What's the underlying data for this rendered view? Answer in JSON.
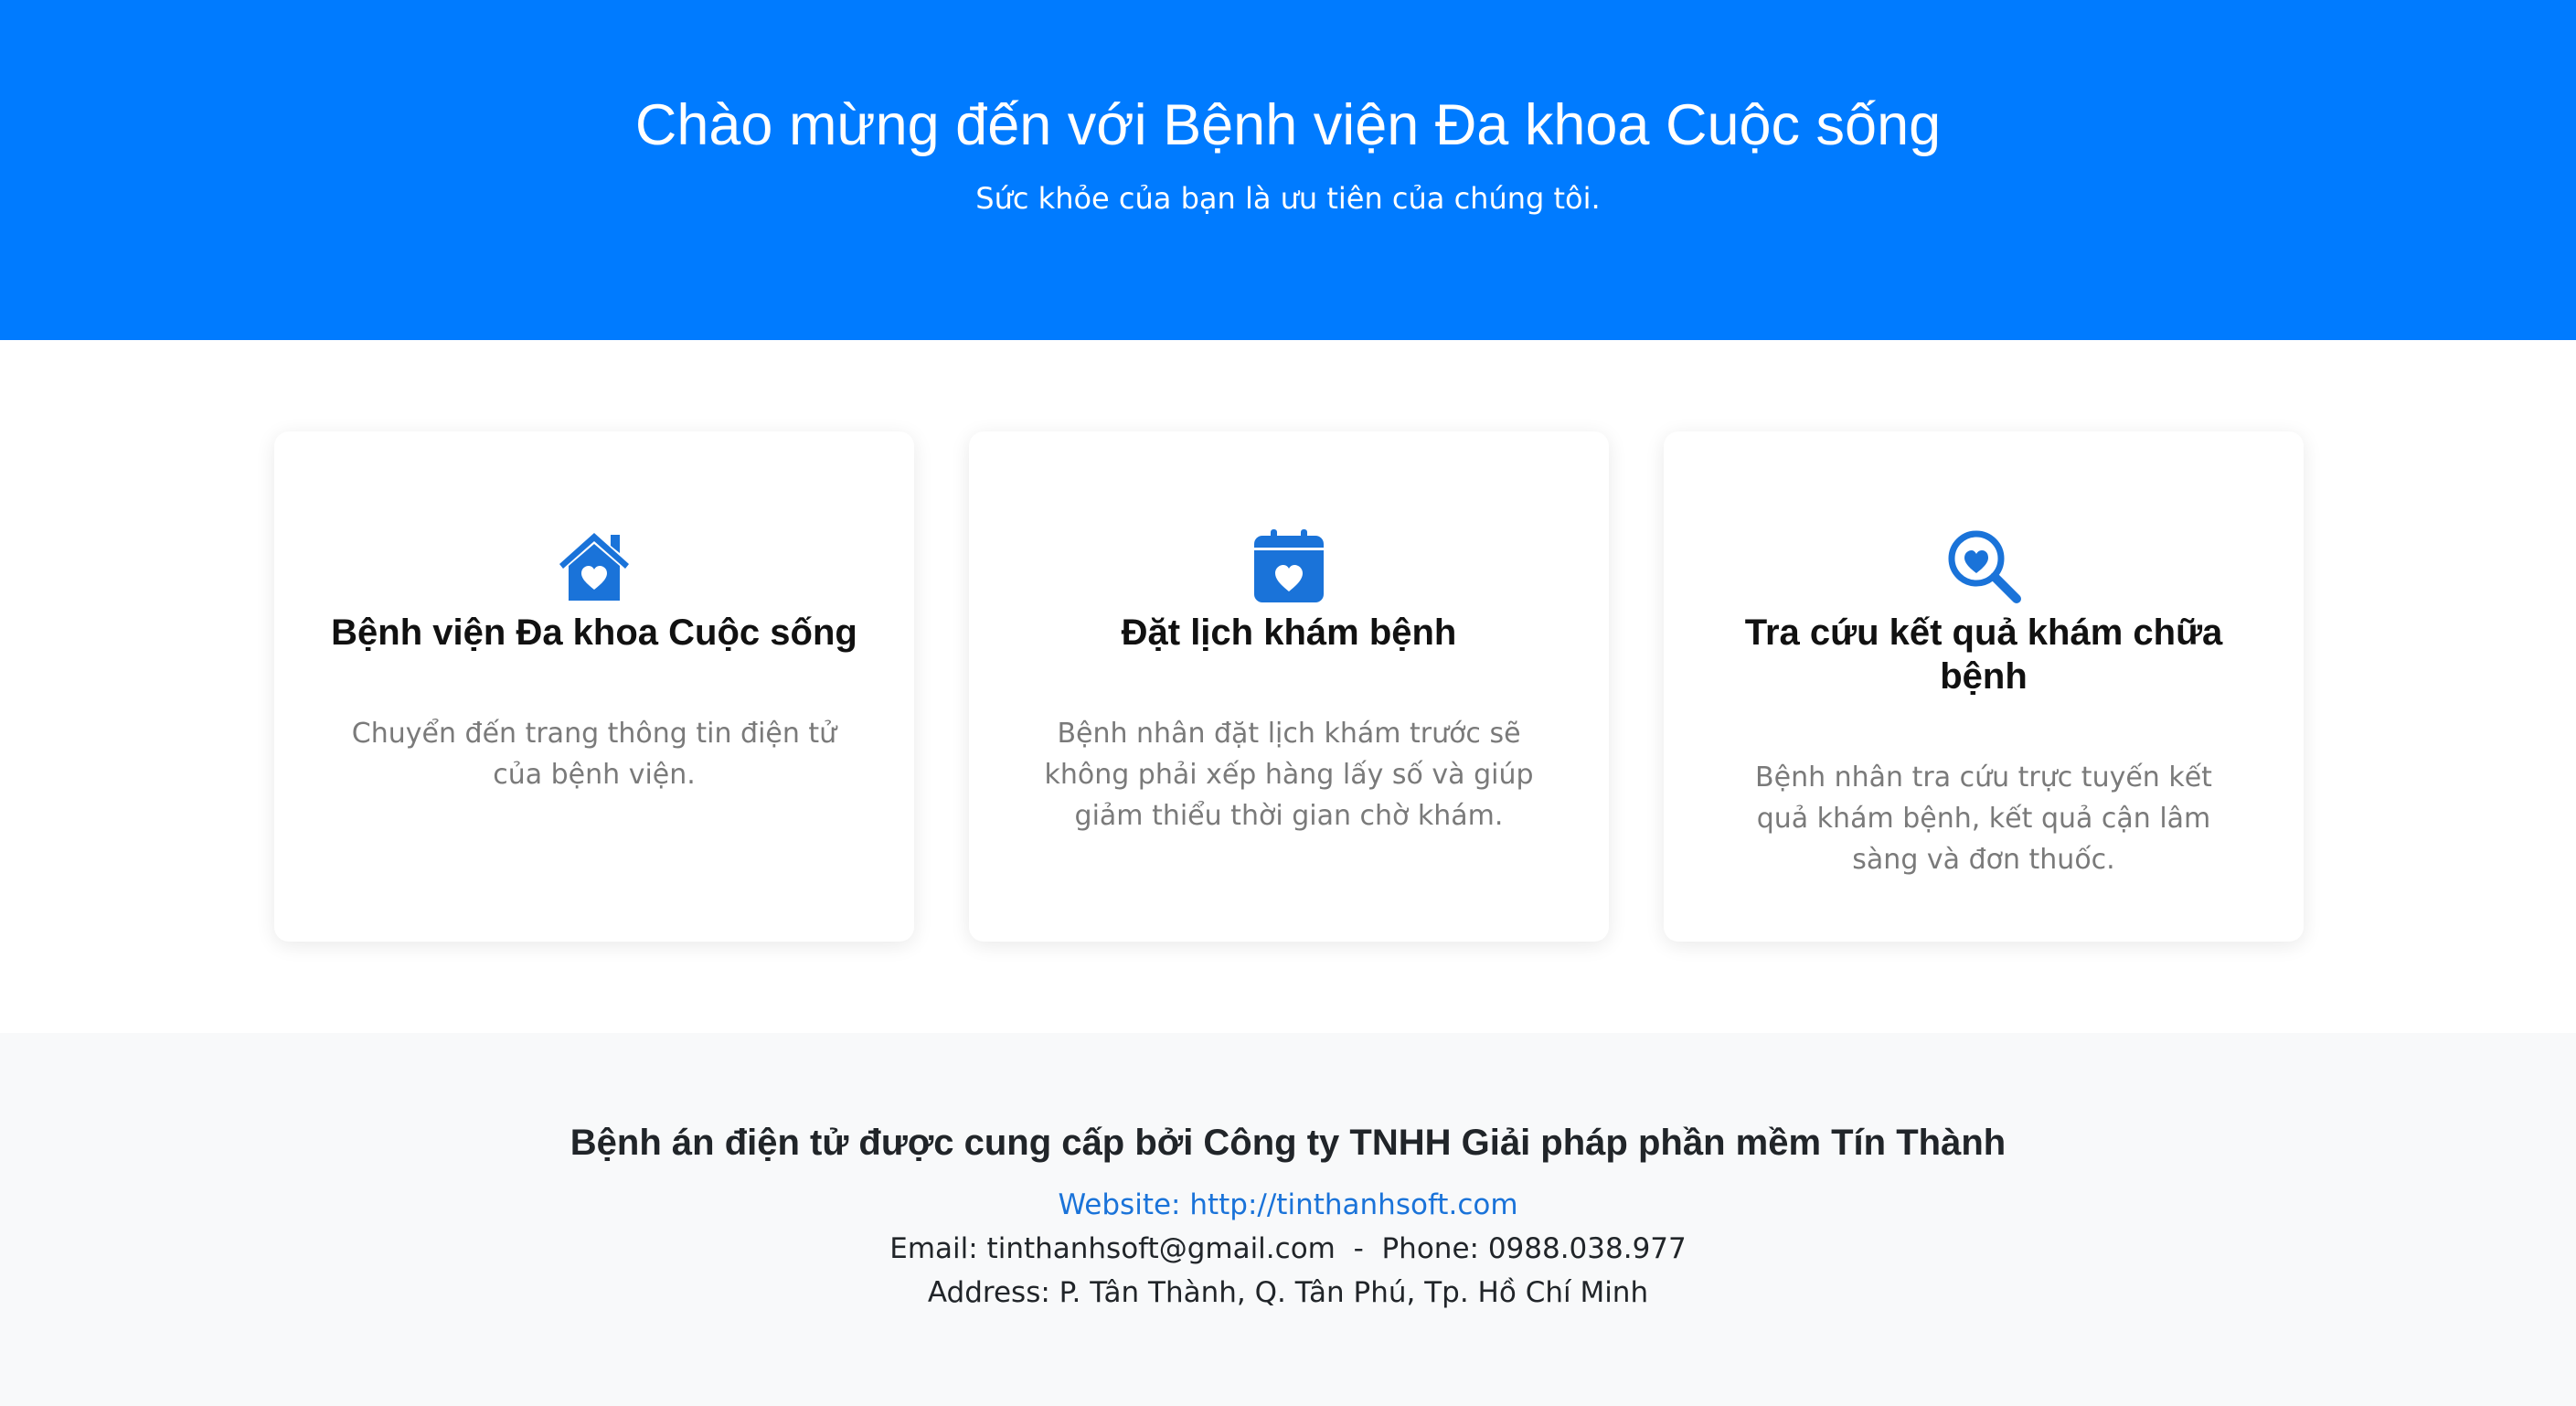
{
  "hero": {
    "title": "Chào mừng đến với Bệnh viện Đa khoa Cuộc sống",
    "subtitle": "Sức khỏe của bạn là ưu tiên của chúng tôi."
  },
  "cards": [
    {
      "icon": "house-heart-icon",
      "title": "Bệnh viện Đa khoa Cuộc sống",
      "description": "Chuyển đến trang thông tin điện tử của bệnh viện."
    },
    {
      "icon": "calendar-heart-icon",
      "title": "Đặt lịch khám bệnh",
      "description": "Bệnh nhân đặt lịch khám trước sẽ không phải xếp hàng lấy số và giúp giảm thiểu thời gian chờ khám."
    },
    {
      "icon": "search-heart-icon",
      "title": "Tra cứu kết quả khám chữa bệnh",
      "description": "Bệnh nhân tra cứu trực tuyến kết quả khám bệnh, kết quả cận lâm sàng và đơn thuốc."
    }
  ],
  "footer": {
    "title": "Bệnh án điện tử được cung cấp bởi Công ty TNHH Giải pháp phần mềm Tín Thành",
    "website_label": "Website: ",
    "website_url": "http://tinthanhsoft.com",
    "email_label": "Email: ",
    "email": "tinthanhsoft@gmail.com",
    "separator": "-",
    "phone_label": "Phone: ",
    "phone": "0988.038.977",
    "address": "Address: P. Tân Thành, Q. Tân Phú, Tp. Hồ Chí Minh"
  },
  "colors": {
    "primary": "#007bff",
    "icon": "#1a73d9",
    "footer_bg": "#f8f9fa",
    "muted_text": "#7a7a7a"
  }
}
